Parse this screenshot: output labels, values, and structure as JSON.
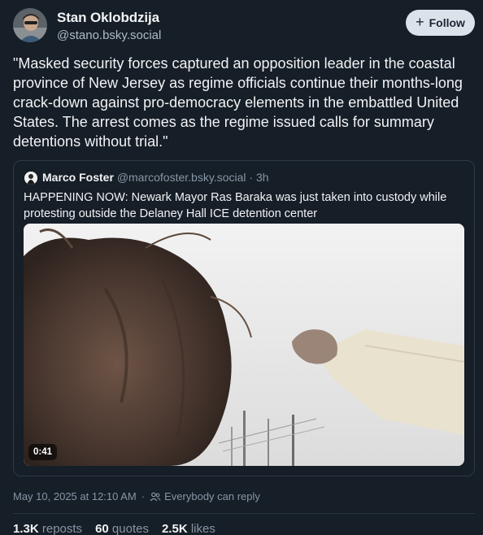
{
  "author": {
    "display_name": "Stan Oklobdzija",
    "handle": "@stano.bsky.social"
  },
  "follow_button": {
    "label": "Follow",
    "icon": "plus-icon"
  },
  "post": {
    "text": "\"Masked security forces captured an opposition leader in the coastal province of New Jersey as regime officials continue their months-long crack-down against pro-democracy elements in the embattled United States. The arrest comes as the regime issued calls for summary detentions without trial.\""
  },
  "quoted_post": {
    "author_name": "Marco Foster",
    "handle": "@marcofoster.bsky.social",
    "separator": " · ",
    "time_ago": "3h",
    "text": "HAPPENING NOW: Newark Mayor Ras Baraka was just taken into custody while protesting outside the Delaney Hall ICE detention center",
    "video": {
      "duration": "0:41"
    }
  },
  "meta": {
    "timestamp": "May 10, 2025 at 12:10 AM",
    "separator": "·",
    "reply_setting": "Everybody can reply",
    "reply_icon": "people-icon"
  },
  "stats": {
    "reposts_count": "1.3K",
    "reposts_label": "reposts",
    "quotes_count": "60",
    "quotes_label": "quotes",
    "likes_count": "2.5K",
    "likes_label": "likes"
  },
  "colors": {
    "background": "#161e27",
    "text_primary": "#f1f3f5",
    "text_secondary": "#8796a6",
    "follow_bg": "#dce2ea",
    "border": "#2e3a46"
  }
}
